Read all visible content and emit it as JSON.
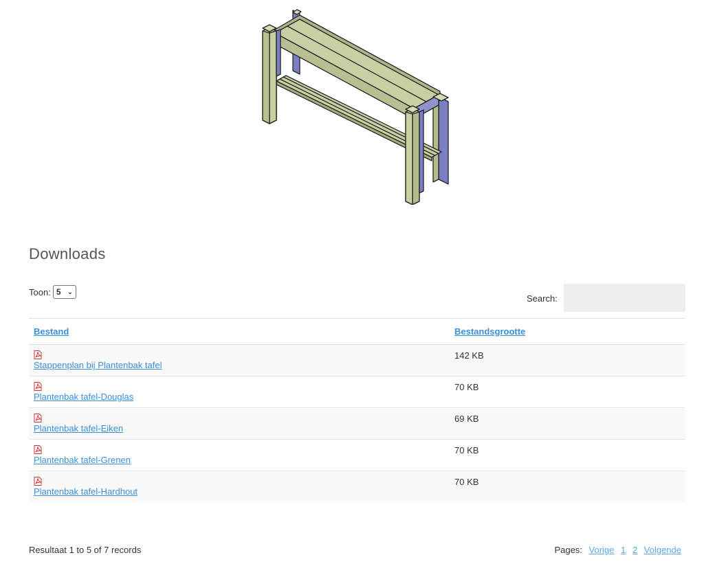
{
  "section_title": "Downloads",
  "toolbar": {
    "show_label": "Toon:",
    "show_value": "5",
    "search_label": "Search:",
    "search_value": ""
  },
  "table": {
    "headers": [
      "Bestand",
      "Bestandsgrootte"
    ],
    "rows": [
      {
        "file": "Stappenplan bij Plantenbak tafel",
        "size": "142 KB",
        "icon": "pdf-icon"
      },
      {
        "file": "Plantenbak tafel-Douglas",
        "size": "70 KB",
        "icon": "pdf-icon"
      },
      {
        "file": "Plantenbak tafel-Eiken",
        "size": "69 KB",
        "icon": "pdf-icon"
      },
      {
        "file": "Plantenbak tafel-Grenen",
        "size": "70 KB",
        "icon": "pdf-icon"
      },
      {
        "file": "Plantenbak tafel-Hardhout",
        "size": "70 KB",
        "icon": "pdf-icon"
      }
    ]
  },
  "footer": {
    "result_text": "Resultaat 1 to 5 of 7 records",
    "pages_label": "Pages:",
    "prev_label": "Vorige",
    "page_1": "1",
    "page_2": "2",
    "next_label": "Volgende"
  },
  "colors": {
    "link": "#3a8fd8",
    "wood_top": "#c9cfa3",
    "wood_side": "#7b7fc2"
  }
}
